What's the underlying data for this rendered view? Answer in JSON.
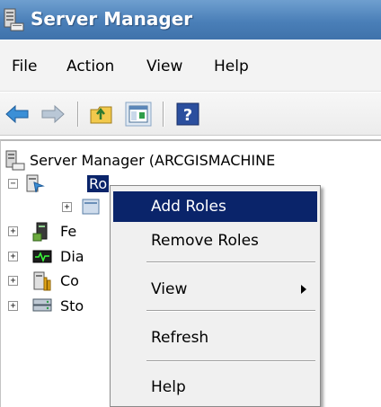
{
  "window": {
    "title": "Server Manager",
    "icon": "server-manager-icon"
  },
  "menubar": {
    "items": [
      "File",
      "Action",
      "View",
      "Help"
    ]
  },
  "toolbar": {
    "buttons": [
      "back-arrow-icon",
      "forward-arrow-icon",
      "up-folder-icon",
      "show-hide-console-tree-icon",
      "help-icon"
    ]
  },
  "tree": {
    "root_label": "Server Manager (ARCGISMACHINE",
    "items": [
      {
        "label": "Ro",
        "expander": "−",
        "icon": "roles-icon",
        "selected": true
      },
      {
        "label": "",
        "expander": "+",
        "icon": "role-subitem-icon"
      },
      {
        "label": "Fe",
        "expander": "+",
        "icon": "features-icon"
      },
      {
        "label": "Dia",
        "expander": "+",
        "icon": "diagnostics-icon"
      },
      {
        "label": "Co",
        "expander": "+",
        "icon": "configuration-icon"
      },
      {
        "label": "Sto",
        "expander": "+",
        "icon": "storage-icon"
      }
    ]
  },
  "context_menu": {
    "items": [
      {
        "label": "Add Roles",
        "highlighted": true
      },
      {
        "label": "Remove Roles"
      },
      {
        "label": "View",
        "has_submenu": true
      },
      {
        "label": "Refresh"
      },
      {
        "label": "Help"
      }
    ]
  },
  "colors": {
    "titlebar": "#4a7fb8",
    "selection": "#0a246a",
    "menu_background": "#f0f0f0"
  }
}
